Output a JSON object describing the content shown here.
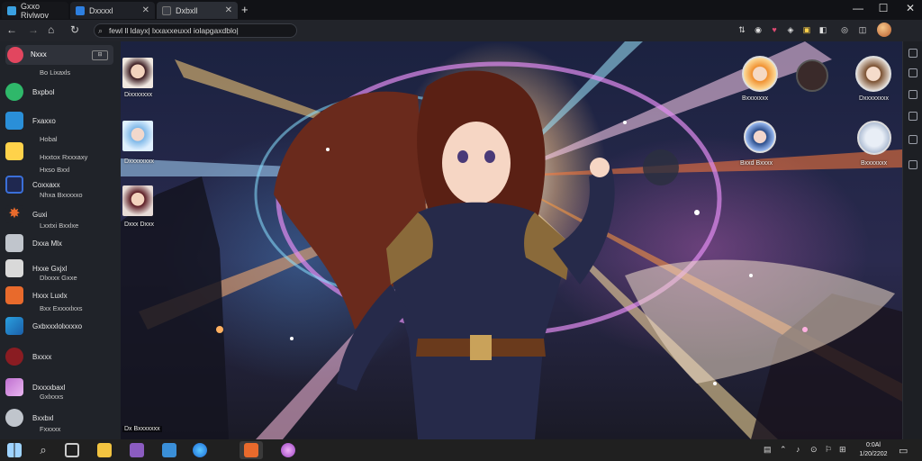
{
  "browser": {
    "tabs": [
      {
        "label": "Gxxo Rivlwov",
        "color": "#3aa0e0"
      },
      {
        "label": "Dxxxxl",
        "color": "#2d7fe0"
      },
      {
        "label": "Dxbxll",
        "color": "#3b3e46"
      }
    ],
    "tab_close": "✕",
    "new_tab": "+",
    "window_controls": [
      "—",
      "☐",
      "✕"
    ],
    "nav": {
      "back": "←",
      "forward": "→",
      "home": "⌂",
      "reload": "↻"
    },
    "address": "fewl ll ldayx| lxxaxxeuxxl iolapgaxdblo|",
    "extension_icons": [
      {
        "glyph": "⇅",
        "color": "#d0d0d0"
      },
      {
        "glyph": "◉",
        "color": "#f0f0f0"
      },
      {
        "glyph": "♥",
        "color": "#e04a73"
      },
      {
        "glyph": "◈",
        "color": "#c9d0ff"
      },
      {
        "glyph": "▣",
        "color": "#ffd24a"
      },
      {
        "glyph": "◧",
        "color": "#c9c9c9"
      },
      {
        "glyph": "◎",
        "color": "#c9c9c9"
      },
      {
        "glyph": "◫",
        "color": "#c9c9c9"
      }
    ]
  },
  "sidebar": {
    "first": {
      "label": "Nxxx",
      "mini": "⊟"
    },
    "items": [
      {
        "sub": "Bo Lixaxls",
        "icon": "#ffffff"
      },
      {
        "label": "Bxpbol",
        "icon": "#2fb86a"
      },
      {
        "label": "Fxaxxo",
        "icon": "#2a8fd8"
      },
      {
        "sub": "Hobal",
        "icon": "#ffd24a"
      },
      {
        "sub": "Hxxtox Rxxxaxy",
        "icon": "#ffffff"
      },
      {
        "sub": "Hxso Bxxl",
        "icon": "#ffffff"
      },
      {
        "label": "Coxxaxx",
        "icon": "#3a6fd8"
      },
      {
        "sub": "Nhxa Bxxxxxo",
        "icon": "#ffffff"
      },
      {
        "label": "Guxi",
        "icon": "#e86a2c"
      },
      {
        "sub": "Lxxtxi Bxxlxe",
        "icon": "#ffffff"
      },
      {
        "label": "Dxxa Mlx",
        "icon": "#c0c5cc"
      },
      {
        "label": "Hxxe Gxjxl",
        "icon": "#d9d9d9"
      },
      {
        "sub": "Dlxxxx Gxxe",
        "icon": "#ffffff"
      },
      {
        "label": "Hxxx Luxlx",
        "icon": "#e86a2c"
      },
      {
        "sub": "Bxx Exxxxlxxs",
        "icon": "#ffffff"
      },
      {
        "label": "Gxbxxxlolxxxxo",
        "icon": "#2aa0e0"
      },
      {
        "label": "Bxxxx",
        "icon": "#8a1c22"
      },
      {
        "label": "Dxxxxbaxl",
        "icon": "#c070d0"
      },
      {
        "sub": "Gxlxxxs",
        "icon": "#ffffff"
      },
      {
        "label": "Bxxbxl",
        "icon": "#c0c5cc"
      },
      {
        "sub": "Fxxxxx",
        "icon": "#ffffff"
      }
    ]
  },
  "gallery": {
    "left_avatars": [
      {
        "label": "Dixxxxxxx"
      },
      {
        "label": "Dxxxxxxxx"
      },
      {
        "label": "Dxxx Dxxx"
      }
    ],
    "right_avatars": [
      {
        "label": "Bxxxxxxx"
      },
      {
        "label": "Dxxxxxxxx"
      },
      {
        "label": "Bxxd Bxxxx"
      },
      {
        "label": "Bxxxxxxx"
      }
    ],
    "corner_label": "Dx Bxxxxxxx",
    "scene": "anime-warrior-illustration"
  },
  "taskbar": {
    "tray_glyphs": [
      "▤",
      "⌃",
      "♪",
      "⊙",
      "⚐",
      "⊞"
    ],
    "clock_time": "0:0Al",
    "clock_date": "1/20/2202",
    "notification_glyph": "▭"
  },
  "colors": {
    "accent": "#2d7fe0",
    "titlebar": "#111216",
    "sidebar": "#202329",
    "taskbar": "#202020"
  }
}
